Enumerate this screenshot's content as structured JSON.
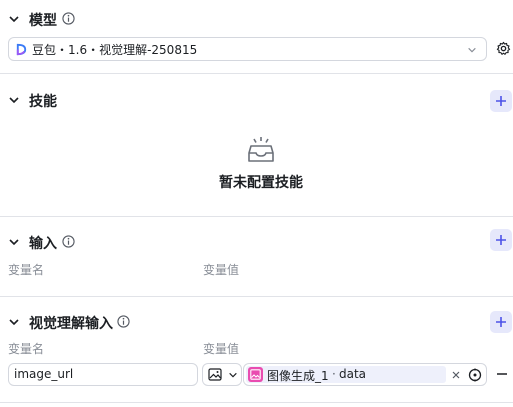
{
  "model": {
    "title": "模型",
    "selected": "豆包・1.6・视觉理解-250815"
  },
  "skills": {
    "title": "技能",
    "empty_text": "暂未配置技能"
  },
  "input": {
    "title": "输入",
    "col_name": "变量名",
    "col_value": "变量值"
  },
  "vision_input": {
    "title": "视觉理解输入",
    "col_name": "变量名",
    "col_value": "变量值",
    "row": {
      "name": "image_url",
      "ref_node": "图像生成_1",
      "ref_sep": "·",
      "ref_field": "data"
    }
  },
  "icons": [
    "chevron-down-icon",
    "info-icon",
    "gear-icon",
    "plus-icon",
    "empty-tray-icon",
    "image-icon",
    "close-icon",
    "target-icon",
    "minus-icon"
  ],
  "colors": {
    "accent": "#4d53e8",
    "add_bg": "#e6e8fb",
    "ref_icon": "#e94cb0",
    "ref_bg": "#eef0fb"
  }
}
